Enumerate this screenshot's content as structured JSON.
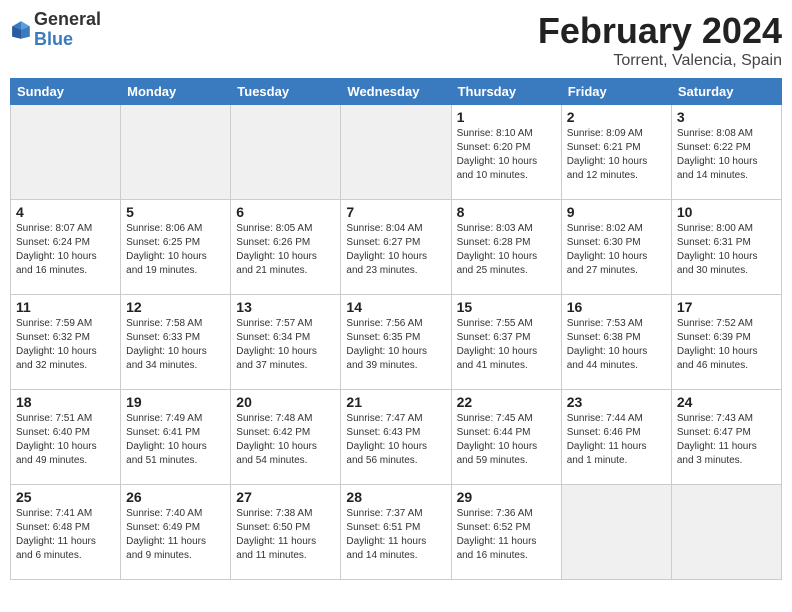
{
  "header": {
    "logo_general": "General",
    "logo_blue": "Blue",
    "title": "February 2024",
    "subtitle": "Torrent, Valencia, Spain"
  },
  "days_of_week": [
    "Sunday",
    "Monday",
    "Tuesday",
    "Wednesday",
    "Thursday",
    "Friday",
    "Saturday"
  ],
  "weeks": [
    [
      {
        "day": "",
        "info": "",
        "shaded": true
      },
      {
        "day": "",
        "info": "",
        "shaded": true
      },
      {
        "day": "",
        "info": "",
        "shaded": true
      },
      {
        "day": "",
        "info": "",
        "shaded": true
      },
      {
        "day": "1",
        "info": "Sunrise: 8:10 AM\nSunset: 6:20 PM\nDaylight: 10 hours and 10 minutes.",
        "shaded": false
      },
      {
        "day": "2",
        "info": "Sunrise: 8:09 AM\nSunset: 6:21 PM\nDaylight: 10 hours and 12 minutes.",
        "shaded": false
      },
      {
        "day": "3",
        "info": "Sunrise: 8:08 AM\nSunset: 6:22 PM\nDaylight: 10 hours and 14 minutes.",
        "shaded": false
      }
    ],
    [
      {
        "day": "4",
        "info": "Sunrise: 8:07 AM\nSunset: 6:24 PM\nDaylight: 10 hours and 16 minutes.",
        "shaded": false
      },
      {
        "day": "5",
        "info": "Sunrise: 8:06 AM\nSunset: 6:25 PM\nDaylight: 10 hours and 19 minutes.",
        "shaded": false
      },
      {
        "day": "6",
        "info": "Sunrise: 8:05 AM\nSunset: 6:26 PM\nDaylight: 10 hours and 21 minutes.",
        "shaded": false
      },
      {
        "day": "7",
        "info": "Sunrise: 8:04 AM\nSunset: 6:27 PM\nDaylight: 10 hours and 23 minutes.",
        "shaded": false
      },
      {
        "day": "8",
        "info": "Sunrise: 8:03 AM\nSunset: 6:28 PM\nDaylight: 10 hours and 25 minutes.",
        "shaded": false
      },
      {
        "day": "9",
        "info": "Sunrise: 8:02 AM\nSunset: 6:30 PM\nDaylight: 10 hours and 27 minutes.",
        "shaded": false
      },
      {
        "day": "10",
        "info": "Sunrise: 8:00 AM\nSunset: 6:31 PM\nDaylight: 10 hours and 30 minutes.",
        "shaded": false
      }
    ],
    [
      {
        "day": "11",
        "info": "Sunrise: 7:59 AM\nSunset: 6:32 PM\nDaylight: 10 hours and 32 minutes.",
        "shaded": false
      },
      {
        "day": "12",
        "info": "Sunrise: 7:58 AM\nSunset: 6:33 PM\nDaylight: 10 hours and 34 minutes.",
        "shaded": false
      },
      {
        "day": "13",
        "info": "Sunrise: 7:57 AM\nSunset: 6:34 PM\nDaylight: 10 hours and 37 minutes.",
        "shaded": false
      },
      {
        "day": "14",
        "info": "Sunrise: 7:56 AM\nSunset: 6:35 PM\nDaylight: 10 hours and 39 minutes.",
        "shaded": false
      },
      {
        "day": "15",
        "info": "Sunrise: 7:55 AM\nSunset: 6:37 PM\nDaylight: 10 hours and 41 minutes.",
        "shaded": false
      },
      {
        "day": "16",
        "info": "Sunrise: 7:53 AM\nSunset: 6:38 PM\nDaylight: 10 hours and 44 minutes.",
        "shaded": false
      },
      {
        "day": "17",
        "info": "Sunrise: 7:52 AM\nSunset: 6:39 PM\nDaylight: 10 hours and 46 minutes.",
        "shaded": false
      }
    ],
    [
      {
        "day": "18",
        "info": "Sunrise: 7:51 AM\nSunset: 6:40 PM\nDaylight: 10 hours and 49 minutes.",
        "shaded": false
      },
      {
        "day": "19",
        "info": "Sunrise: 7:49 AM\nSunset: 6:41 PM\nDaylight: 10 hours and 51 minutes.",
        "shaded": false
      },
      {
        "day": "20",
        "info": "Sunrise: 7:48 AM\nSunset: 6:42 PM\nDaylight: 10 hours and 54 minutes.",
        "shaded": false
      },
      {
        "day": "21",
        "info": "Sunrise: 7:47 AM\nSunset: 6:43 PM\nDaylight: 10 hours and 56 minutes.",
        "shaded": false
      },
      {
        "day": "22",
        "info": "Sunrise: 7:45 AM\nSunset: 6:44 PM\nDaylight: 10 hours and 59 minutes.",
        "shaded": false
      },
      {
        "day": "23",
        "info": "Sunrise: 7:44 AM\nSunset: 6:46 PM\nDaylight: 11 hours and 1 minute.",
        "shaded": false
      },
      {
        "day": "24",
        "info": "Sunrise: 7:43 AM\nSunset: 6:47 PM\nDaylight: 11 hours and 3 minutes.",
        "shaded": false
      }
    ],
    [
      {
        "day": "25",
        "info": "Sunrise: 7:41 AM\nSunset: 6:48 PM\nDaylight: 11 hours and 6 minutes.",
        "shaded": false
      },
      {
        "day": "26",
        "info": "Sunrise: 7:40 AM\nSunset: 6:49 PM\nDaylight: 11 hours and 9 minutes.",
        "shaded": false
      },
      {
        "day": "27",
        "info": "Sunrise: 7:38 AM\nSunset: 6:50 PM\nDaylight: 11 hours and 11 minutes.",
        "shaded": false
      },
      {
        "day": "28",
        "info": "Sunrise: 7:37 AM\nSunset: 6:51 PM\nDaylight: 11 hours and 14 minutes.",
        "shaded": false
      },
      {
        "day": "29",
        "info": "Sunrise: 7:36 AM\nSunset: 6:52 PM\nDaylight: 11 hours and 16 minutes.",
        "shaded": false
      },
      {
        "day": "",
        "info": "",
        "shaded": true
      },
      {
        "day": "",
        "info": "",
        "shaded": true
      }
    ]
  ]
}
